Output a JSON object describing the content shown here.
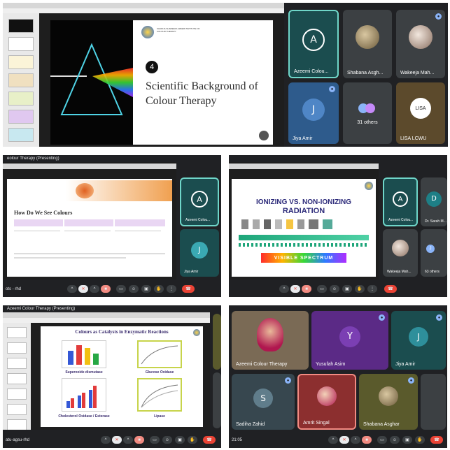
{
  "panel1": {
    "slide_number": "4",
    "slide_title": "Scientific Background of Colour Therapy",
    "institute": "KHADIJA SHAREEFA AZEEM INSTITUTE OF COLOUR THERAPY",
    "participants": [
      {
        "initial": "A",
        "name": "Azeemi Colou..."
      },
      {
        "initial": "",
        "name": "Shabana Asgh..."
      },
      {
        "initial": "",
        "name": "Wakeeja Mah..."
      },
      {
        "initial": "J",
        "name": "Jiya Amir"
      },
      {
        "initial": "",
        "name": "31 others"
      },
      {
        "initial": "",
        "name": "LISA LCWU"
      }
    ]
  },
  "panel2": {
    "window_title": "eolour Therapy (Presenting)",
    "slide_heading": "How Do We See Colours",
    "time_label": "ots - rhd",
    "participants": [
      {
        "initial": "A",
        "name": "Azeemi Colou..."
      },
      {
        "initial": "J",
        "name": "Jiya Amir"
      }
    ]
  },
  "panel3": {
    "slide_title_line1": "IONIZING VS. NON-IONIZING",
    "slide_title_line2": "RADIATION",
    "spectrum_label": "VISIBLE SPECTRUM",
    "participants": [
      {
        "initial": "A",
        "name": "Azeemi Colou..."
      },
      {
        "initial": "D",
        "name": "Dr. Sarah M..."
      },
      {
        "initial": "",
        "name": "Wakeeja Mah..."
      },
      {
        "initial": "J",
        "name": "63 others"
      }
    ]
  },
  "panel4": {
    "window_title": "Azeemi Colour Therapy (Presenting)",
    "slide_title": "Colours as Catalysts in Enzymatic Reactions",
    "captions": [
      "Superoxide dismutase",
      "Glucose Oxidase",
      "Cholesterol Oxidase / Esterase",
      "Lipase"
    ],
    "time_label": "atu-agsu-rhd"
  },
  "panel5": {
    "time_label": "21:05",
    "participants": [
      {
        "initial": "",
        "name": "Azeemi Colour Therapy"
      },
      {
        "initial": "Y",
        "name": "Yusufah Asim"
      },
      {
        "initial": "J",
        "name": "Jiya Amir"
      },
      {
        "initial": "S",
        "name": "Sadiha Zahid"
      },
      {
        "initial": "",
        "name": "Amrit Singal"
      },
      {
        "initial": "",
        "name": "Shabana Asghar"
      }
    ]
  },
  "colors": {
    "meet_bg": "#202124",
    "tile_bg": "#3c4043",
    "teal": "#1b4d4f",
    "purple": "#5b2a86",
    "end_call": "#ea4335"
  },
  "icons": [
    "mic-icon",
    "camera-icon",
    "caption-icon",
    "raise-hand-icon",
    "present-icon",
    "more-icon",
    "end-call-icon"
  ]
}
